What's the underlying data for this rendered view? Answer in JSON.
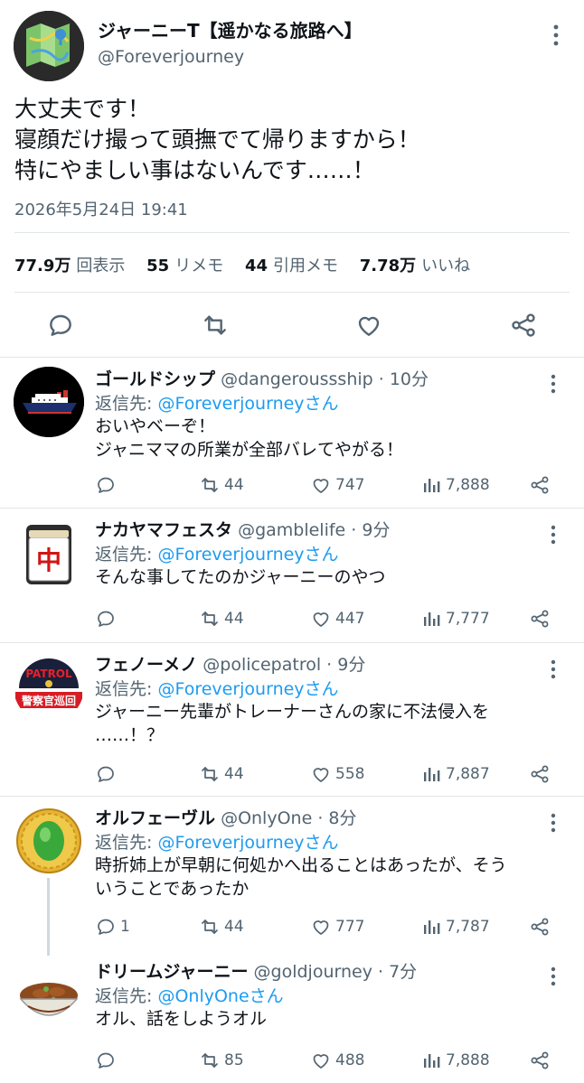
{
  "main_tweet": {
    "display_name": "ジャーニーT【遥かなる旅路へ】",
    "handle": "@Foreverjourney",
    "text": "大丈夫です！\n寝顔だけ撮って頭撫でて帰りますから！\n特にやましい事はないんです……！",
    "timestamp": "2026年5月24日 19:41",
    "stats": {
      "views_count": "77.9万",
      "views_label": "回表示",
      "reposts_count": "55",
      "reposts_label": "リメモ",
      "quotes_count": "44",
      "quotes_label": "引用メモ",
      "likes_count": "7.78万",
      "likes_label": "いいね"
    },
    "icons": [
      "reply-icon",
      "repost-icon",
      "like-icon",
      "share-icon",
      "more-icon"
    ]
  },
  "replies": [
    {
      "display_name": "ゴールドシップ",
      "handle": "@dangeroussship",
      "meta_suffix": " · 10分",
      "reply_prefix": "返信先: ",
      "reply_to": "@Foreverjourneyさん",
      "text": "おいやベーぞ！\nジャニママの所業が全部バレてやがる！",
      "replies": "",
      "reposts": "44",
      "likes": "747",
      "views": "7,888",
      "avatar_icon": "ship-avatar"
    },
    {
      "display_name": "ナカヤマフェスタ",
      "handle": "@gamblelife",
      "meta_suffix": " · 9分",
      "reply_prefix": "返信先: ",
      "reply_to": "@Foreverjourneyさん",
      "text": "そんな事してたのかジャーニーのやつ",
      "replies": "",
      "reposts": "44",
      "likes": "447",
      "views": "7,777",
      "avatar_icon": "mahjong-tile-avatar",
      "avatar_glyph": "中"
    },
    {
      "display_name": "フェノーメノ",
      "handle": "@policepatrol",
      "meta_suffix": " · 9分",
      "reply_prefix": "返信先: ",
      "reply_to": "@Foreverjourneyさん",
      "text": "ジャーニー先輩がトレーナーさんの家に不法侵入を\n……！？",
      "replies": "",
      "reposts": "44",
      "likes": "558",
      "views": "7,887",
      "avatar_icon": "police-patrol-avatar",
      "avatar_top_text": "PATROL",
      "avatar_bottom_text": "警察官巡回"
    },
    {
      "display_name": "オルフェーヴル",
      "handle": "@OnlyOne",
      "meta_suffix": " · 8分",
      "reply_prefix": "返信先: ",
      "reply_to": "@Foreverjourneyさん",
      "text": "時折姉上が早朝に何処かへ出ることはあったが、そう\nいうことであったか",
      "replies": "1",
      "reposts": "44",
      "likes": "777",
      "views": "7,787",
      "avatar_icon": "green-jewel-avatar"
    },
    {
      "display_name": "ドリームジャーニー",
      "handle": "@goldjourney",
      "meta_suffix": " · 7分",
      "reply_prefix": "返信先: ",
      "reply_to": "@OnlyOneさん",
      "text": "オル、話をしようオル",
      "replies": "",
      "reposts": "85",
      "likes": "488",
      "views": "7,888",
      "avatar_icon": "rice-bowl-avatar"
    }
  ],
  "colors": {
    "accent": "#1d9bf0",
    "muted": "#536471",
    "divider": "#e1e6ea",
    "text": "#0f1419"
  }
}
